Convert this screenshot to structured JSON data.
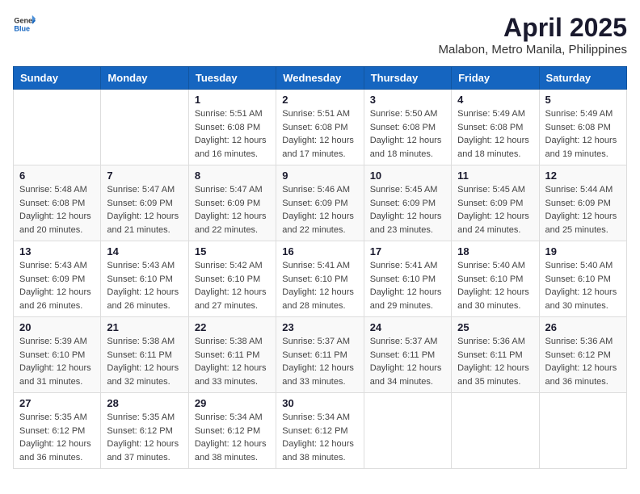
{
  "header": {
    "logo_general": "General",
    "logo_blue": "Blue",
    "month_title": "April 2025",
    "location": "Malabon, Metro Manila, Philippines"
  },
  "weekdays": [
    "Sunday",
    "Monday",
    "Tuesday",
    "Wednesday",
    "Thursday",
    "Friday",
    "Saturday"
  ],
  "weeks": [
    [
      {
        "day": "",
        "sunrise": "",
        "sunset": "",
        "daylight": "",
        "empty": true
      },
      {
        "day": "",
        "sunrise": "",
        "sunset": "",
        "daylight": "",
        "empty": true
      },
      {
        "day": "1",
        "sunrise": "Sunrise: 5:51 AM",
        "sunset": "Sunset: 6:08 PM",
        "daylight": "Daylight: 12 hours and 16 minutes."
      },
      {
        "day": "2",
        "sunrise": "Sunrise: 5:51 AM",
        "sunset": "Sunset: 6:08 PM",
        "daylight": "Daylight: 12 hours and 17 minutes."
      },
      {
        "day": "3",
        "sunrise": "Sunrise: 5:50 AM",
        "sunset": "Sunset: 6:08 PM",
        "daylight": "Daylight: 12 hours and 18 minutes."
      },
      {
        "day": "4",
        "sunrise": "Sunrise: 5:49 AM",
        "sunset": "Sunset: 6:08 PM",
        "daylight": "Daylight: 12 hours and 18 minutes."
      },
      {
        "day": "5",
        "sunrise": "Sunrise: 5:49 AM",
        "sunset": "Sunset: 6:08 PM",
        "daylight": "Daylight: 12 hours and 19 minutes."
      }
    ],
    [
      {
        "day": "6",
        "sunrise": "Sunrise: 5:48 AM",
        "sunset": "Sunset: 6:08 PM",
        "daylight": "Daylight: 12 hours and 20 minutes."
      },
      {
        "day": "7",
        "sunrise": "Sunrise: 5:47 AM",
        "sunset": "Sunset: 6:09 PM",
        "daylight": "Daylight: 12 hours and 21 minutes."
      },
      {
        "day": "8",
        "sunrise": "Sunrise: 5:47 AM",
        "sunset": "Sunset: 6:09 PM",
        "daylight": "Daylight: 12 hours and 22 minutes."
      },
      {
        "day": "9",
        "sunrise": "Sunrise: 5:46 AM",
        "sunset": "Sunset: 6:09 PM",
        "daylight": "Daylight: 12 hours and 22 minutes."
      },
      {
        "day": "10",
        "sunrise": "Sunrise: 5:45 AM",
        "sunset": "Sunset: 6:09 PM",
        "daylight": "Daylight: 12 hours and 23 minutes."
      },
      {
        "day": "11",
        "sunrise": "Sunrise: 5:45 AM",
        "sunset": "Sunset: 6:09 PM",
        "daylight": "Daylight: 12 hours and 24 minutes."
      },
      {
        "day": "12",
        "sunrise": "Sunrise: 5:44 AM",
        "sunset": "Sunset: 6:09 PM",
        "daylight": "Daylight: 12 hours and 25 minutes."
      }
    ],
    [
      {
        "day": "13",
        "sunrise": "Sunrise: 5:43 AM",
        "sunset": "Sunset: 6:09 PM",
        "daylight": "Daylight: 12 hours and 26 minutes."
      },
      {
        "day": "14",
        "sunrise": "Sunrise: 5:43 AM",
        "sunset": "Sunset: 6:10 PM",
        "daylight": "Daylight: 12 hours and 26 minutes."
      },
      {
        "day": "15",
        "sunrise": "Sunrise: 5:42 AM",
        "sunset": "Sunset: 6:10 PM",
        "daylight": "Daylight: 12 hours and 27 minutes."
      },
      {
        "day": "16",
        "sunrise": "Sunrise: 5:41 AM",
        "sunset": "Sunset: 6:10 PM",
        "daylight": "Daylight: 12 hours and 28 minutes."
      },
      {
        "day": "17",
        "sunrise": "Sunrise: 5:41 AM",
        "sunset": "Sunset: 6:10 PM",
        "daylight": "Daylight: 12 hours and 29 minutes."
      },
      {
        "day": "18",
        "sunrise": "Sunrise: 5:40 AM",
        "sunset": "Sunset: 6:10 PM",
        "daylight": "Daylight: 12 hours and 30 minutes."
      },
      {
        "day": "19",
        "sunrise": "Sunrise: 5:40 AM",
        "sunset": "Sunset: 6:10 PM",
        "daylight": "Daylight: 12 hours and 30 minutes."
      }
    ],
    [
      {
        "day": "20",
        "sunrise": "Sunrise: 5:39 AM",
        "sunset": "Sunset: 6:10 PM",
        "daylight": "Daylight: 12 hours and 31 minutes."
      },
      {
        "day": "21",
        "sunrise": "Sunrise: 5:38 AM",
        "sunset": "Sunset: 6:11 PM",
        "daylight": "Daylight: 12 hours and 32 minutes."
      },
      {
        "day": "22",
        "sunrise": "Sunrise: 5:38 AM",
        "sunset": "Sunset: 6:11 PM",
        "daylight": "Daylight: 12 hours and 33 minutes."
      },
      {
        "day": "23",
        "sunrise": "Sunrise: 5:37 AM",
        "sunset": "Sunset: 6:11 PM",
        "daylight": "Daylight: 12 hours and 33 minutes."
      },
      {
        "day": "24",
        "sunrise": "Sunrise: 5:37 AM",
        "sunset": "Sunset: 6:11 PM",
        "daylight": "Daylight: 12 hours and 34 minutes."
      },
      {
        "day": "25",
        "sunrise": "Sunrise: 5:36 AM",
        "sunset": "Sunset: 6:11 PM",
        "daylight": "Daylight: 12 hours and 35 minutes."
      },
      {
        "day": "26",
        "sunrise": "Sunrise: 5:36 AM",
        "sunset": "Sunset: 6:12 PM",
        "daylight": "Daylight: 12 hours and 36 minutes."
      }
    ],
    [
      {
        "day": "27",
        "sunrise": "Sunrise: 5:35 AM",
        "sunset": "Sunset: 6:12 PM",
        "daylight": "Daylight: 12 hours and 36 minutes."
      },
      {
        "day": "28",
        "sunrise": "Sunrise: 5:35 AM",
        "sunset": "Sunset: 6:12 PM",
        "daylight": "Daylight: 12 hours and 37 minutes."
      },
      {
        "day": "29",
        "sunrise": "Sunrise: 5:34 AM",
        "sunset": "Sunset: 6:12 PM",
        "daylight": "Daylight: 12 hours and 38 minutes."
      },
      {
        "day": "30",
        "sunrise": "Sunrise: 5:34 AM",
        "sunset": "Sunset: 6:12 PM",
        "daylight": "Daylight: 12 hours and 38 minutes."
      },
      {
        "day": "",
        "sunrise": "",
        "sunset": "",
        "daylight": "",
        "empty": true
      },
      {
        "day": "",
        "sunrise": "",
        "sunset": "",
        "daylight": "",
        "empty": true
      },
      {
        "day": "",
        "sunrise": "",
        "sunset": "",
        "daylight": "",
        "empty": true
      }
    ]
  ]
}
